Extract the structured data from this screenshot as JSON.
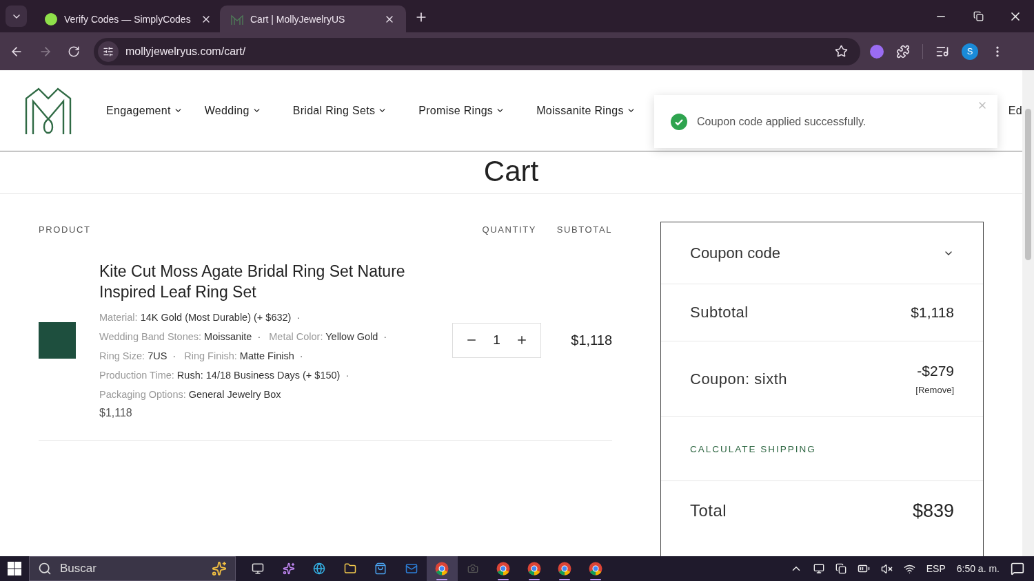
{
  "browser": {
    "tabs": [
      {
        "title": "Verify Codes — SimplyCodes",
        "selected": false,
        "kind": "simplycodes"
      },
      {
        "title": "Cart | MollyJewelryUS",
        "selected": true,
        "kind": "molly"
      }
    ],
    "url": "mollyjewelryus.com/cart/",
    "profile_initial": "S"
  },
  "header": {
    "nav": [
      {
        "label": "Engagement",
        "has_menu": true
      },
      {
        "label": "Wedding",
        "has_menu": true
      },
      {
        "label": "Bridal Ring Sets",
        "has_menu": true
      },
      {
        "label": "Promise Rings",
        "has_menu": true
      },
      {
        "label": "Moissanite Rings",
        "has_menu": true
      },
      {
        "label": "Ed",
        "has_menu": false
      }
    ]
  },
  "toast": {
    "message": "Coupon code applied successfully."
  },
  "page_title": "Cart",
  "cart": {
    "columns": [
      "PRODUCT",
      "QUANTITY",
      "SUBTOTAL"
    ],
    "item": {
      "name": "Kite Cut Moss Agate Bridal Ring Set Nature Inspired Leaf Ring Set",
      "separator": "·",
      "options": [
        {
          "label": "Material:",
          "value": "14K Gold (Most Durable) (+ $632)"
        },
        {
          "label": "Wedding Band Stones:",
          "value": "Moissanite"
        },
        {
          "label": "Metal Color:",
          "value": "Yellow Gold"
        },
        {
          "label": "Ring Size:",
          "value": "7US"
        },
        {
          "label": "Ring Finish:",
          "value": "Matte Finish"
        },
        {
          "label": "Production Time:",
          "value": "Rush: 14/18 Business Days (+ $150)"
        },
        {
          "label": "Packaging Options:",
          "value": "General Jewelry Box"
        }
      ],
      "price": "$1,118",
      "quantity": "1",
      "subtotal": "$1,118"
    }
  },
  "summary": {
    "coupon_toggle": "Coupon code",
    "rows": [
      {
        "kind": "subtotal",
        "label": "Subtotal",
        "value": "$1,118"
      },
      {
        "kind": "coupon",
        "label": "Coupon: sixth",
        "value": "-$279",
        "action": "[Remove]"
      },
      {
        "kind": "shipping",
        "label": "CALCULATE SHIPPING"
      },
      {
        "kind": "total",
        "label": "Total",
        "value": "$839"
      }
    ]
  },
  "taskbar": {
    "search_placeholder": "Buscar",
    "apps": [
      {
        "kind": "taskview",
        "active": false,
        "open": false
      },
      {
        "kind": "copilot",
        "active": false,
        "open": false
      },
      {
        "kind": "edge",
        "active": false,
        "open": false
      },
      {
        "kind": "files",
        "active": false,
        "open": false
      },
      {
        "kind": "store",
        "active": false,
        "open": false
      },
      {
        "kind": "outlook",
        "active": false,
        "open": false
      },
      {
        "kind": "chrome",
        "active": true,
        "open": true
      },
      {
        "kind": "dark",
        "active": false,
        "open": false
      },
      {
        "kind": "chrome",
        "active": false,
        "open": true
      },
      {
        "kind": "chrome",
        "active": false,
        "open": true
      },
      {
        "kind": "chrome",
        "active": false,
        "open": true
      },
      {
        "kind": "chrome",
        "active": false,
        "open": true
      }
    ],
    "language": "ESP",
    "time": "6:50 a. m."
  }
}
